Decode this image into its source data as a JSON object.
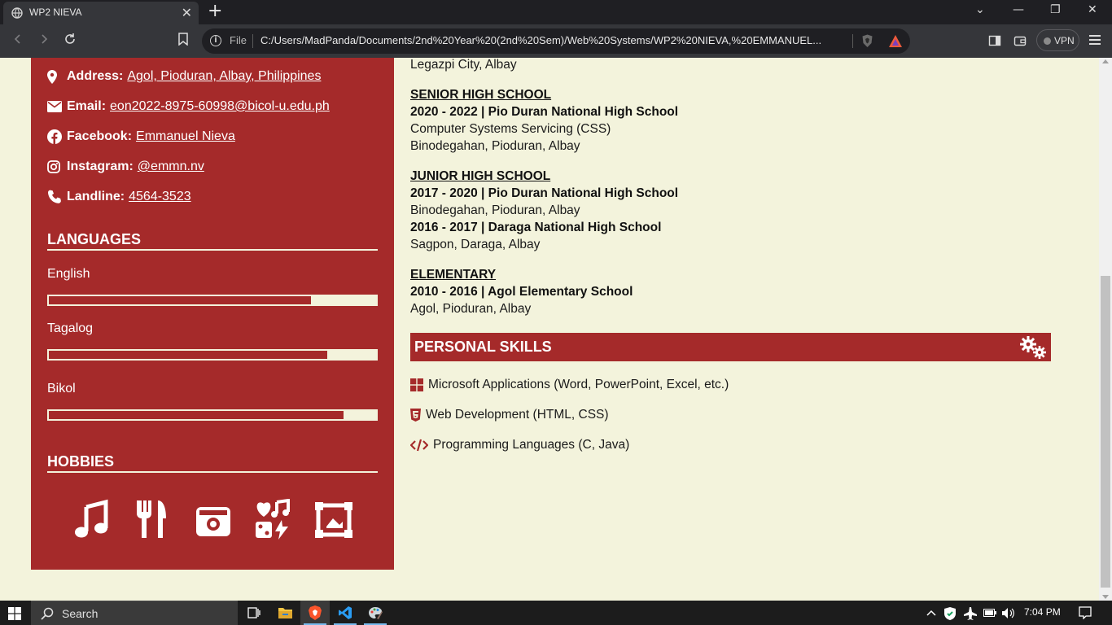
{
  "browser": {
    "tab_title": "WP2 NIEVA",
    "tab_close": "✕",
    "new_tab": "+",
    "omnibox_scheme": "File",
    "url": "C:/Users/MadPanda/Documents/2nd%20Year%20(2nd%20Sem)/Web%20Systems/WP2%20NIEVA,%20EMMANUEL...",
    "vpn_label": "VPN",
    "win_minimize": "—",
    "win_restore": "❐",
    "win_close": "✕",
    "win_dropdown": "⌄"
  },
  "sidebar": {
    "contacts": [
      {
        "icon": "map-pin-icon",
        "label": "Address:",
        "value": "Agol, Pioduran, Albay, Philippines"
      },
      {
        "icon": "envelope-icon",
        "label": "Email:",
        "value": "eon2022-8975-60998@bicol-u.edu.ph"
      },
      {
        "icon": "facebook-icon",
        "label": "Facebook:",
        "value": "Emmanuel Nieva"
      },
      {
        "icon": "instagram-icon",
        "label": "Instagram:",
        "value": "@emmn.nv"
      },
      {
        "icon": "phone-icon",
        "label": "Landline:",
        "value": "4564-3523"
      }
    ],
    "languages_title": "LANGUAGES",
    "languages": [
      {
        "name": "English",
        "level": 0.8
      },
      {
        "name": "Tagalog",
        "level": 0.85
      },
      {
        "name": "Bikol",
        "level": 0.9
      }
    ],
    "hobbies_title": "HOBBIES",
    "hobbies": [
      "music-note-icon",
      "utensils-icon",
      "camera-icon",
      "heart-music-gaming-icon",
      "picture-frame-icon"
    ]
  },
  "main": {
    "top_partial_line": "Legazpi City, Albay",
    "senior_high": {
      "heading": "SENIOR HIGH SCHOOL",
      "title": "2020 - 2022 | Pio Duran National High School",
      "strand": "Computer Systems Servicing (CSS)",
      "location": "Binodegahan, Pioduran, Albay"
    },
    "junior_high": {
      "heading": "JUNIOR HIGH SCHOOL",
      "title1": "2017 - 2020 | Pio Duran National High School",
      "location1": "Binodegahan, Pioduran, Albay",
      "title2": "2016 - 2017 | Daraga National High School",
      "location2": "Sagpon, Daraga, Albay"
    },
    "elementary": {
      "heading": "ELEMENTARY",
      "title": "2010 - 2016 | Agol Elementary School",
      "location": "Agol, Pioduran, Albay"
    },
    "skills_title": "PERSONAL SKILLS",
    "skills": [
      {
        "icon": "windows-icon",
        "text": "Microsoft Applications (Word, PowerPoint, Excel, etc.)"
      },
      {
        "icon": "html5-icon",
        "text": "Web Development (HTML, CSS)"
      },
      {
        "icon": "code-icon",
        "text": "Programming Languages (C, Java)"
      }
    ]
  },
  "taskbar": {
    "search_placeholder": "Search",
    "time": "7:04 PM"
  },
  "colors": {
    "accent": "#a52a2a",
    "page_bg": "#f3f3dc"
  }
}
